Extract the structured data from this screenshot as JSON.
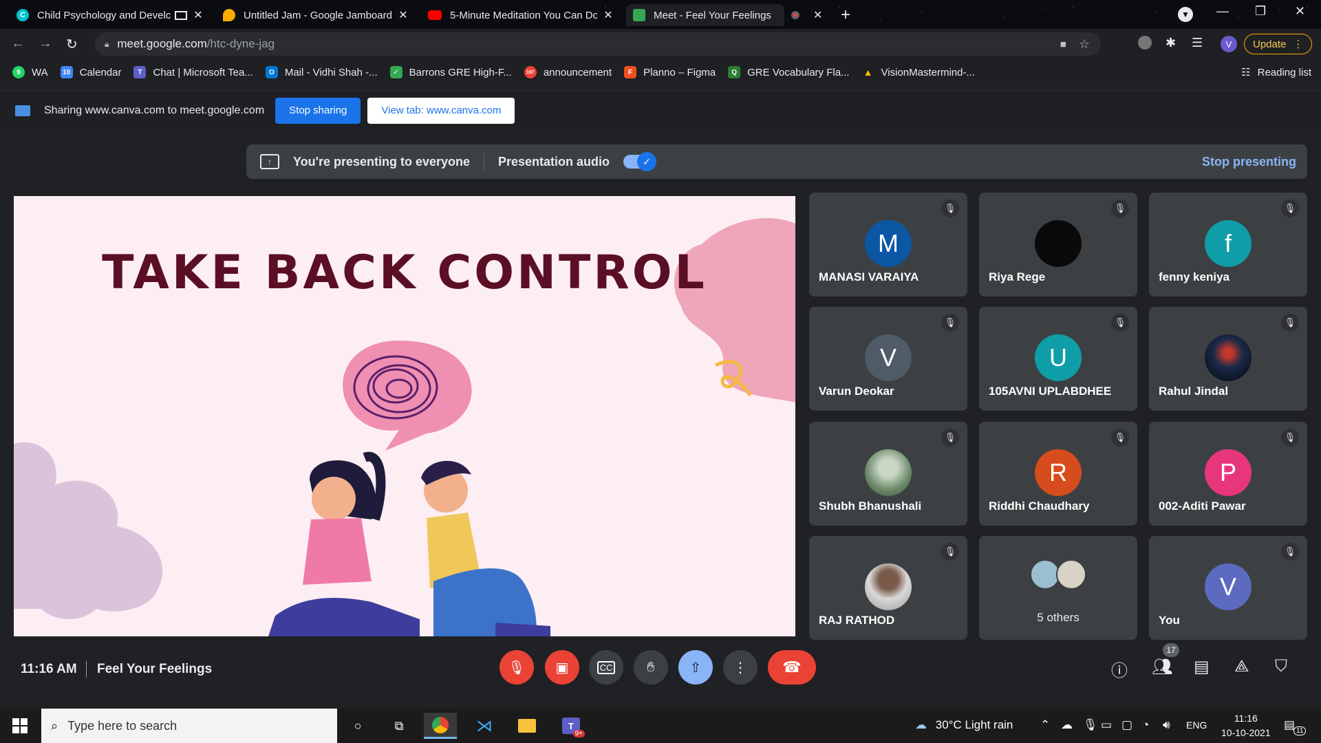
{
  "browser": {
    "tabs": [
      {
        "title": "Child Psychology and Develc",
        "icon": "canva-icon",
        "color": "#00c4cc",
        "letter": "C"
      },
      {
        "title": "Untitled Jam - Google Jamboard",
        "icon": "jamboard-icon",
        "color": "#f9ab00",
        "letter": ""
      },
      {
        "title": "5-Minute Meditation You Can Do",
        "icon": "youtube-icon",
        "color": "#ff0000",
        "letter": ""
      },
      {
        "title": "Meet - Feel Your Feelings",
        "icon": "meet-icon",
        "color": "#34a853",
        "letter": ""
      }
    ],
    "url_host": "meet.google.com",
    "url_path": "/htc-dyne-jag",
    "profile_letter": "V",
    "update_label": "Update",
    "bookmarks": [
      {
        "label": "WA",
        "color": "#25d366",
        "glyph": "9"
      },
      {
        "label": "Calendar",
        "color": "#4285f4",
        "glyph": "10"
      },
      {
        "label": "Chat | Microsoft Tea...",
        "color": "#5b5fc7",
        "glyph": "T"
      },
      {
        "label": "Mail - Vidhi Shah -...",
        "color": "#0078d4",
        "glyph": "O"
      },
      {
        "label": "Barrons GRE High-F...",
        "color": "#34a853",
        "glyph": "✓"
      },
      {
        "label": "announcement",
        "color": "#ea4335",
        "glyph": "197"
      },
      {
        "label": "Planno – Figma",
        "color": "#f24e1e",
        "glyph": "F"
      },
      {
        "label": "GRE Vocabulary Fla...",
        "color": "#2e7d32",
        "glyph": "Q"
      },
      {
        "label": "VisionMastermind-...",
        "color": "#fbbc04",
        "glyph": "▲"
      }
    ],
    "reading_list": "Reading list"
  },
  "sharebar": {
    "text": "Sharing www.canva.com to meet.google.com",
    "stop_label": "Stop sharing",
    "view_label": "View tab: www.canva.com"
  },
  "presenting": {
    "text": "You're presenting to everyone",
    "audio_label": "Presentation audio",
    "stop_label": "Stop presenting"
  },
  "slide": {
    "title": "TAKE BACK CONTROL"
  },
  "participants": [
    {
      "name": "MANASI VARAIYA",
      "letter": "M",
      "color": "#0b57a4"
    },
    {
      "name": "Riya Rege",
      "letter": "",
      "color": "#0a0a0a"
    },
    {
      "name": "fenny keniya",
      "letter": "f",
      "color": "#0f9ea8"
    },
    {
      "name": "Varun Deokar",
      "letter": "V",
      "color": "#4f5b66"
    },
    {
      "name": "105AVNI UPLABDHEE",
      "letter": "U",
      "color": "#0f9ea8"
    },
    {
      "name": "Rahul Jindal",
      "letter": "",
      "color": "#1a2a48"
    },
    {
      "name": "Shubh Bhanushali",
      "letter": "",
      "color": "#6d8a6a"
    },
    {
      "name": "Riddhi Chaudhary",
      "letter": "R",
      "color": "#d64c1c"
    },
    {
      "name": "002-Aditi Pawar",
      "letter": "P",
      "color": "#e8367d"
    },
    {
      "name": "RAJ RATHOD",
      "letter": "",
      "color": "#b9b9b9"
    },
    {
      "name": "5 others",
      "letter": "",
      "color": "#9bbfd1"
    },
    {
      "name": "You",
      "letter": "V",
      "color": "#5c6bc0"
    }
  ],
  "controls": {
    "time": "11:16 AM",
    "meeting_name": "Feel Your Feelings",
    "people_count": "17"
  },
  "taskbar": {
    "search_placeholder": "Type here to search",
    "weather": "30°C  Light rain",
    "lang": "ENG",
    "time": "11:16",
    "date": "10-10-2021",
    "notif_count": "11",
    "teams_badge": "9+"
  }
}
